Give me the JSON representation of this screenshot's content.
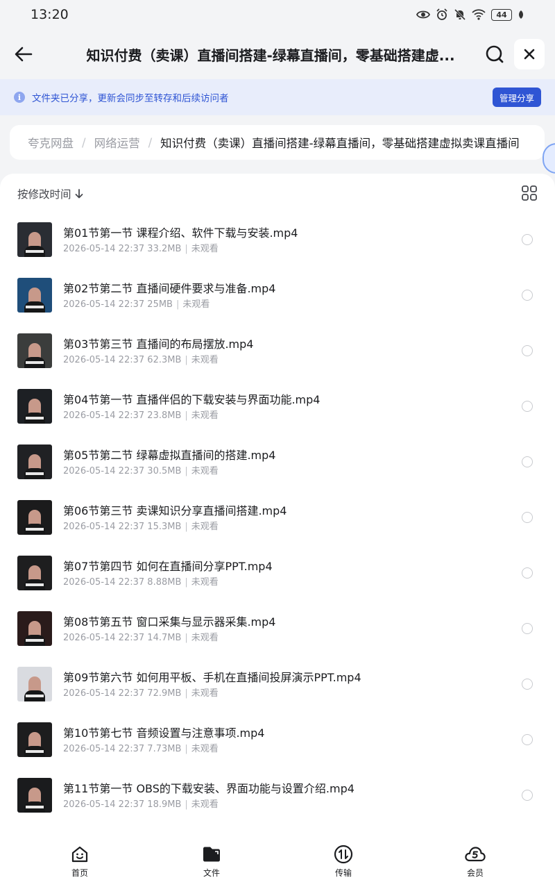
{
  "status_bar": {
    "time": "13:20",
    "battery": "44",
    "icons": [
      "eye-icon",
      "alarm-icon",
      "mute-icon",
      "wifi-icon",
      "battery-icon",
      "leaf-icon"
    ]
  },
  "header": {
    "title": "知识付费（卖课）直播间搭建-绿幕直播间，零基础搭建虚...",
    "back_icon": "arrow-left-icon",
    "search_icon": "search-icon",
    "close_icon": "close-icon"
  },
  "share_banner": {
    "text": "文件夹已分享，更新会同步至转存和后续访问者",
    "button_label": "管理分享",
    "accent_color": "#2f55d4"
  },
  "breadcrumb": {
    "items": [
      "夸克网盘",
      "网络运营",
      "知识付费（卖课）直播间搭建-绿幕直播间，零基础搭建虚拟卖课直播间"
    ],
    "separator": "/"
  },
  "toolbar": {
    "sort_label": "按修改时间",
    "sort_icon": "arrow-down-icon",
    "view_icon": "grid-view-icon"
  },
  "files": [
    {
      "name": "第01节第一节 课程介绍、软件下载与安装.mp4",
      "date": "2026-05-14 22:37",
      "size": "33.2MB",
      "status": "未观看"
    },
    {
      "name": "第02节第二节 直播间硬件要求与准备.mp4",
      "date": "2026-05-14 22:37",
      "size": "25MB",
      "status": "未观看"
    },
    {
      "name": "第03节第三节 直播间的布局摆放.mp4",
      "date": "2026-05-14 22:37",
      "size": "62.3MB",
      "status": "未观看"
    },
    {
      "name": "第04节第一节 直播伴侣的下载安装与界面功能.mp4",
      "date": "2026-05-14 22:37",
      "size": "23.8MB",
      "status": "未观看"
    },
    {
      "name": "第05节第二节 绿幕虚拟直播间的搭建.mp4",
      "date": "2026-05-14 22:37",
      "size": "30.5MB",
      "status": "未观看"
    },
    {
      "name": "第06节第三节 卖课知识分享直播间搭建.mp4",
      "date": "2026-05-14 22:37",
      "size": "15.3MB",
      "status": "未观看"
    },
    {
      "name": "第07节第四节 如何在直播间分享PPT.mp4",
      "date": "2026-05-14 22:37",
      "size": "8.88MB",
      "status": "未观看"
    },
    {
      "name": "第08节第五节 窗口采集与显示器采集.mp4",
      "date": "2026-05-14 22:37",
      "size": "14.7MB",
      "status": "未观看"
    },
    {
      "name": "第09节第六节 如何用平板、手机在直播间投屏演示PPT.mp4",
      "date": "2026-05-14 22:37",
      "size": "72.9MB",
      "status": "未观看"
    },
    {
      "name": "第10节第七节 音频设置与注意事项.mp4",
      "date": "2026-05-14 22:37",
      "size": "7.73MB",
      "status": "未观看"
    },
    {
      "name": "第11节第一节 OBS的下载安装、界面功能与设置介绍.mp4",
      "date": "2026-05-14 22:37",
      "size": "18.9MB",
      "status": "未观看"
    }
  ],
  "bottom_nav": [
    {
      "label": "首页",
      "icon": "home-smile-icon"
    },
    {
      "label": "文件",
      "icon": "folder-icon"
    },
    {
      "label": "传输",
      "icon": "transfer-icon"
    },
    {
      "label": "会员",
      "icon": "vip-cloud-icon"
    }
  ]
}
